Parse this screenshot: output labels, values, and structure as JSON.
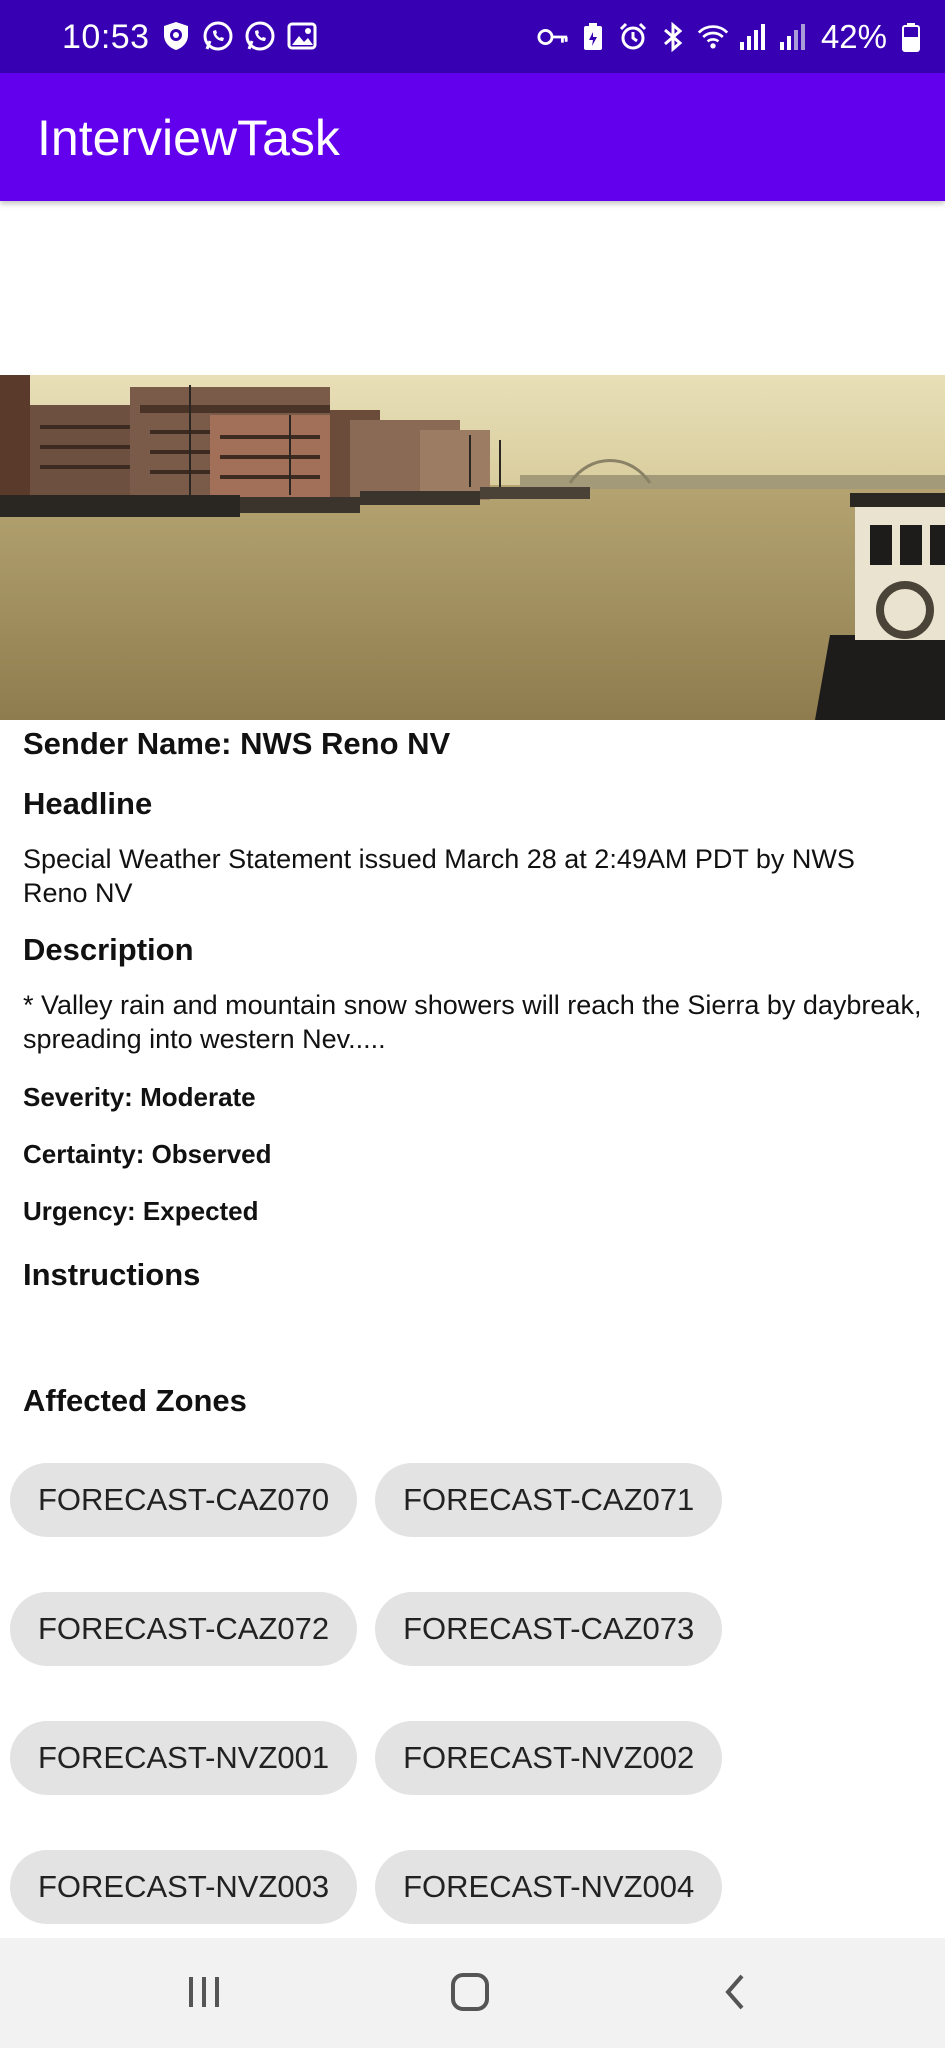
{
  "status_bar": {
    "time": "10:53",
    "battery": "42%",
    "left_icons": [
      "vpn-shield-icon",
      "whatsapp-icon",
      "whatsapp-icon",
      "gallery-icon"
    ],
    "right_icons": [
      "key-icon",
      "battery-saver-icon",
      "alarm-icon",
      "bluetooth-icon",
      "wifi-icon",
      "signal-icon",
      "signal-icon",
      "battery-icon"
    ]
  },
  "app_bar": {
    "title": "InterviewTask"
  },
  "alert": {
    "sender": "Sender Name: NWS Reno NV",
    "headline_label": "Headline",
    "headline": "Special Weather Statement issued March 28 at 2:49AM PDT by NWS Reno NV",
    "description_label": "Description",
    "description": "* Valley rain and mountain snow showers will reach the Sierra by daybreak, spreading into western Nev.....",
    "severity": "Severity: Moderate",
    "certainty": "Certainty: Observed",
    "urgency": "Urgency: Expected",
    "instructions_label": "Instructions",
    "zones_label": "Affected Zones",
    "zones": [
      "FORECAST-CAZ070",
      "FORECAST-CAZ071",
      "FORECAST-CAZ072",
      "FORECAST-CAZ073",
      "FORECAST-NVZ001",
      "FORECAST-NVZ002",
      "FORECAST-NVZ003",
      "FORECAST-NVZ004"
    ]
  },
  "colors": {
    "status_bar": "#3700b3",
    "app_bar": "#6200ee",
    "chip_bg": "#e3e3e3",
    "nav_bar": "#f2f2f2"
  },
  "nav_bar": {
    "icons": [
      "recents-icon",
      "home-icon",
      "back-icon"
    ]
  }
}
